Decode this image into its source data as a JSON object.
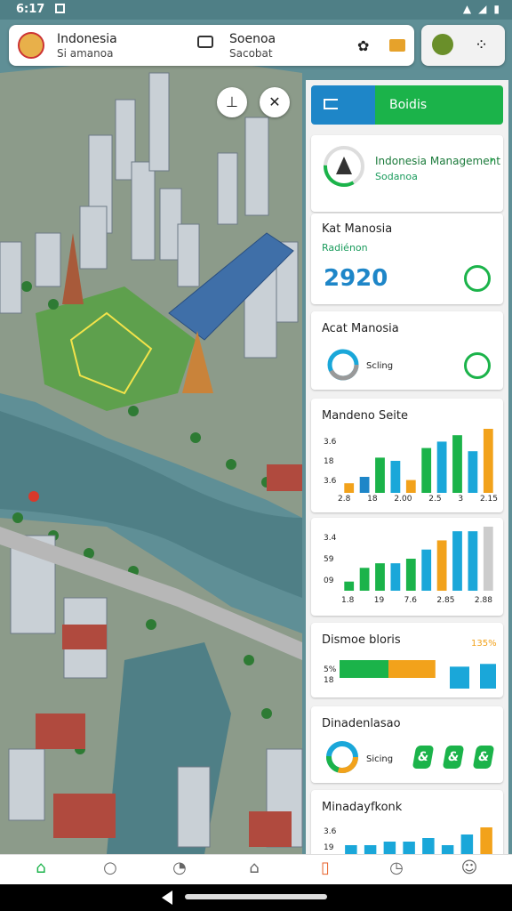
{
  "status_bar": {
    "time": "6:17"
  },
  "top_bar": {
    "location_title": "Indonesia",
    "location_subtitle": "Si amanoa",
    "center_title": "Soenoa",
    "center_subtitle": "Sacobat"
  },
  "panel": {
    "tab_label": "Boidis",
    "card_profile": {
      "title": "Indonesia Management",
      "subtitle": "Sodanoa"
    },
    "card_stat": {
      "title": "Kat Manosia",
      "subtitle": "Radiénon",
      "value": "2920"
    },
    "card_ring": {
      "title": "Acat Manosia",
      "label": "Scling"
    },
    "chart1": {
      "title": "Mandeno Seite",
      "y_ticks": [
        "3.6",
        "18",
        "3.6"
      ],
      "x_ticks": [
        "2.8",
        "18",
        "2.00",
        "2.5",
        "3",
        "2.15"
      ]
    },
    "chart2": {
      "y_ticks": [
        "3.4",
        "59",
        "09"
      ],
      "x_ticks": [
        "1.8",
        "19",
        "7.6",
        "2.85",
        "2.88"
      ]
    },
    "chart3": {
      "title": "Dismoe bloris",
      "percent": "135%",
      "y_ticks": [
        "5%",
        "18"
      ]
    },
    "card_donut": {
      "title": "Dinadenlasao",
      "label": "Sicing"
    },
    "chart4": {
      "title": "Minadayfkonk",
      "y_ticks": [
        "3.6",
        "19"
      ]
    }
  },
  "chart_data": [
    {
      "type": "bar",
      "title": "Mandeno Seite",
      "categories": [
        "2.8",
        "18",
        "2.00",
        "2.5",
        "3",
        "2.15"
      ],
      "series": [
        {
          "values": [
            3,
            5,
            11,
            10,
            4,
            14,
            16,
            18,
            13,
            20
          ]
        }
      ],
      "ylim": [
        0,
        20
      ]
    },
    {
      "type": "bar",
      "categories": [
        "1.8",
        "19",
        "7.6",
        "2.85",
        "2.88"
      ],
      "series": [
        {
          "values": [
            2,
            5,
            6,
            6,
            7,
            9,
            11,
            13,
            13,
            14
          ]
        }
      ],
      "ylim": [
        0,
        14
      ]
    },
    {
      "type": "bar",
      "title": "Dismoe bloris",
      "series": [
        {
          "values": [
            50,
            48,
            20,
            20,
            56,
            63
          ]
        }
      ],
      "ylim": [
        0,
        100
      ]
    },
    {
      "type": "bar",
      "title": "Minadayfkonk",
      "series": [
        {
          "values": [
            3,
            3,
            4,
            4,
            5,
            3,
            6,
            8
          ]
        }
      ],
      "ylim": [
        0,
        10
      ]
    }
  ],
  "colors": {
    "green": "#1bb34a",
    "blue": "#1e86c8",
    "light_blue": "#1aa7d9",
    "orange": "#f2a21b"
  }
}
